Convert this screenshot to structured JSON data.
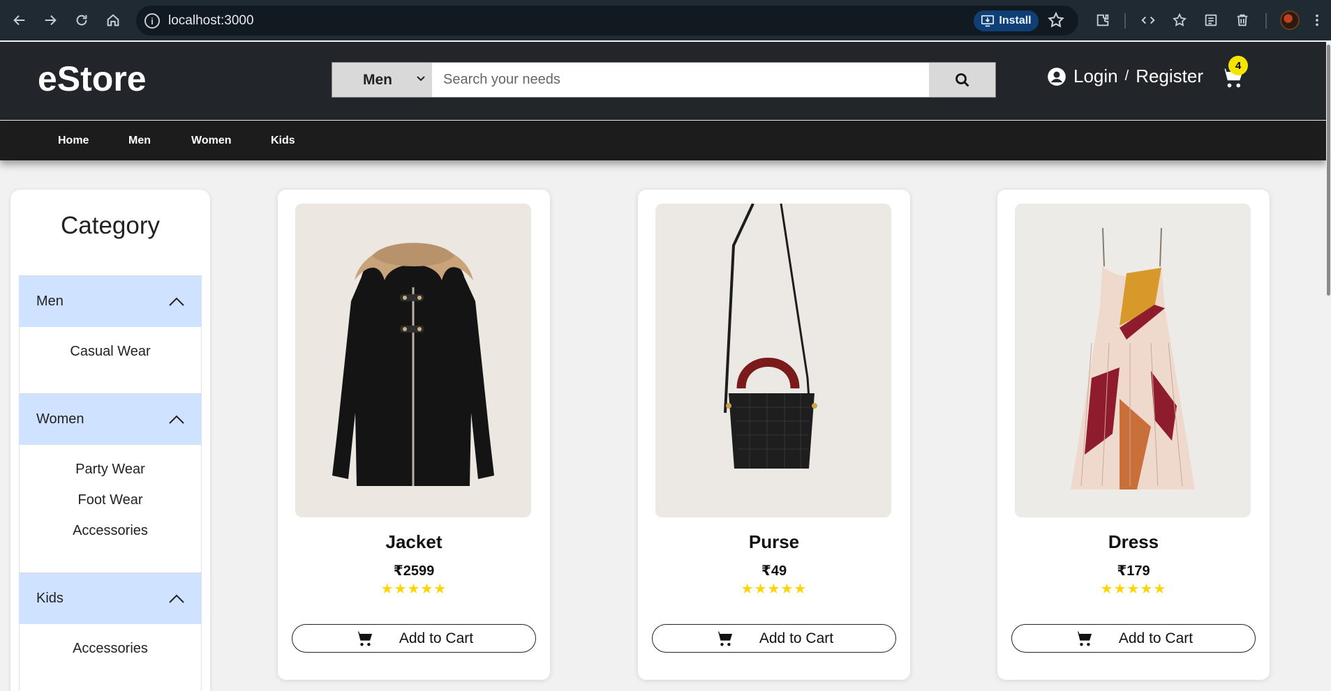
{
  "browser": {
    "url": "localhost:3000",
    "install_label": "Install"
  },
  "store": {
    "logo": "eStore",
    "search": {
      "category_selected": "Men",
      "placeholder": "Search your needs"
    },
    "login_label": "Login",
    "login_sep": "/",
    "register_label": "Register",
    "cart_count": "4"
  },
  "nav": [
    "Home",
    "Men",
    "Women",
    "Kids"
  ],
  "sidebar": {
    "title": "Category",
    "groups": [
      {
        "label": "Men",
        "items": [
          "Casual Wear"
        ]
      },
      {
        "label": "Women",
        "items": [
          "Party Wear",
          "Foot Wear",
          "Accessories"
        ]
      },
      {
        "label": "Kids",
        "items": [
          "Accessories"
        ]
      }
    ]
  },
  "products": [
    {
      "name": "Jacket",
      "price": "₹2599",
      "rating": 5,
      "stars": "★★★★★",
      "cta": "Add to Cart",
      "image_icon": "jacket-image"
    },
    {
      "name": "Purse",
      "price": "₹49",
      "rating": 5,
      "stars": "★★★★★",
      "cta": "Add to Cart",
      "image_icon": "purse-image"
    },
    {
      "name": "Dress",
      "price": "₹179",
      "rating": 5,
      "stars": "★★★★★",
      "cta": "Add to Cart",
      "image_icon": "dress-image"
    }
  ],
  "colors": {
    "header_bg": "#22262b",
    "nav_bg": "#1c1c1c",
    "accordion_bg": "#cfe2ff",
    "badge": "#f5e400",
    "star": "#ffd400"
  }
}
